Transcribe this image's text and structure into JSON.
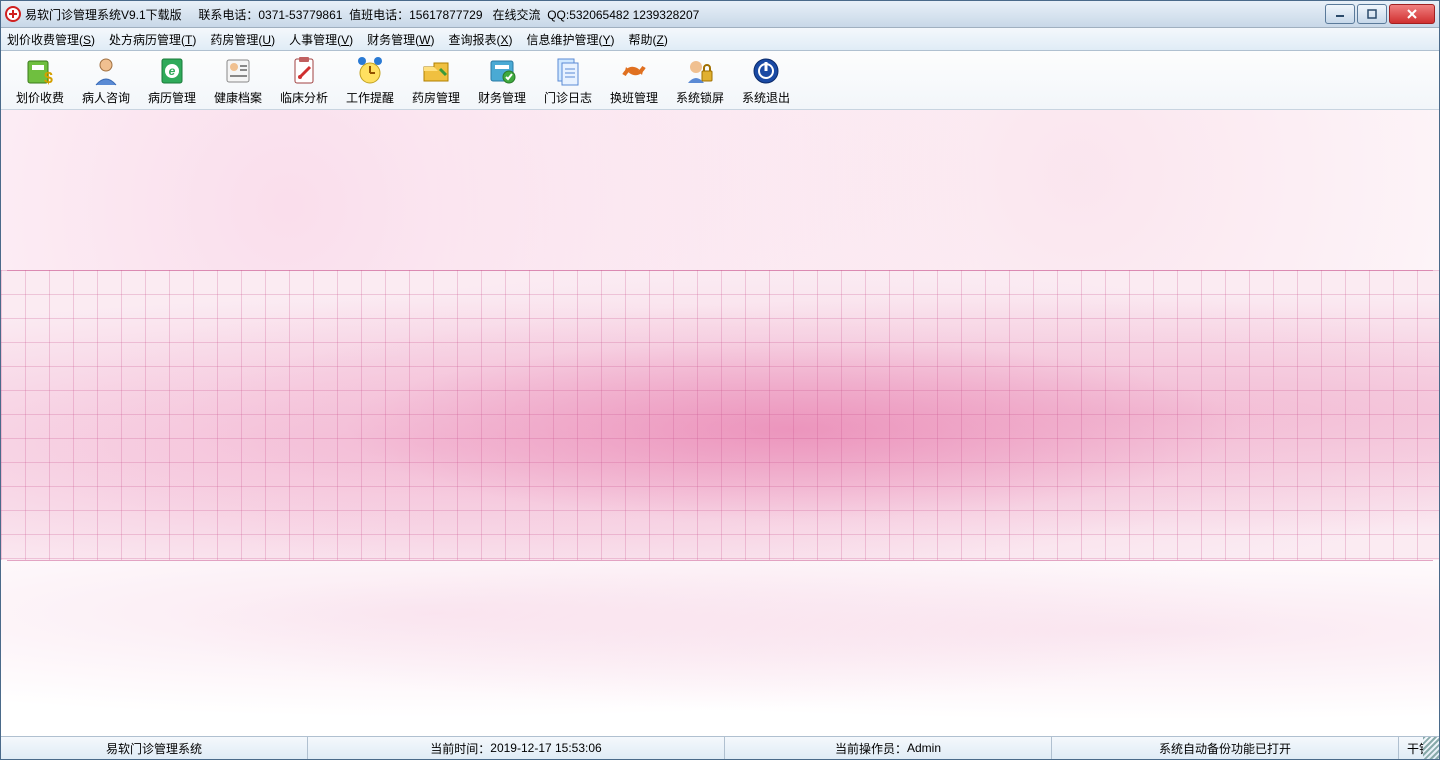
{
  "titlebar": {
    "title": "易软门诊管理系统V9.1下载版     联系电话：0371-53779861  值班电话：15617877729   在线交流  QQ:532065482 1239328207"
  },
  "menubar": {
    "items": [
      {
        "label": "划价收费管理",
        "accel": "S"
      },
      {
        "label": "处方病历管理",
        "accel": "T"
      },
      {
        "label": "药房管理",
        "accel": "U"
      },
      {
        "label": "人事管理",
        "accel": "V"
      },
      {
        "label": "财务管理",
        "accel": "W"
      },
      {
        "label": "查询报表",
        "accel": "X"
      },
      {
        "label": "信息维护管理",
        "accel": "Y"
      },
      {
        "label": "帮助",
        "accel": "Z"
      }
    ]
  },
  "toolbar": {
    "items": [
      {
        "label": "划价收费",
        "icon": "pricing-icon"
      },
      {
        "label": "病人咨询",
        "icon": "patient-icon"
      },
      {
        "label": "病历管理",
        "icon": "record-icon"
      },
      {
        "label": "健康档案",
        "icon": "health-file-icon"
      },
      {
        "label": "临床分析",
        "icon": "clinical-icon"
      },
      {
        "label": "工作提醒",
        "icon": "reminder-icon"
      },
      {
        "label": "药房管理",
        "icon": "pharmacy-icon"
      },
      {
        "label": "财务管理",
        "icon": "finance-icon"
      },
      {
        "label": "门诊日志",
        "icon": "log-icon"
      },
      {
        "label": "换班管理",
        "icon": "shift-icon"
      },
      {
        "label": "系统锁屏",
        "icon": "lock-icon"
      },
      {
        "label": "系统退出",
        "icon": "exit-icon"
      }
    ]
  },
  "statusbar": {
    "app_name": "易软门诊管理系统",
    "time_label": "当前时间：",
    "time_value": "2019-12-17 15:53:06",
    "user_label": "当前操作员：",
    "user_value": "Admin",
    "backup": "系统自动备份功能已打开",
    "tail": "干钱箱;鼠标右"
  }
}
